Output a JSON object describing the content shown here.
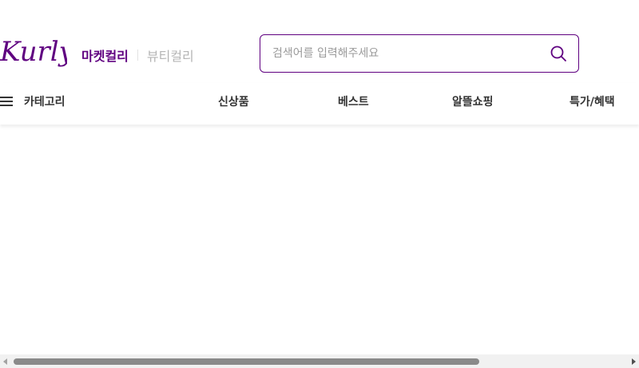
{
  "header": {
    "logo_text": "Kurly",
    "tabs": {
      "market": "마켓컬리",
      "beauty": "뷰티컬리"
    },
    "search": {
      "placeholder": "검색어를 입력해주세요",
      "value": ""
    }
  },
  "nav": {
    "category_label": "카테고리",
    "items": [
      "신상품",
      "베스트",
      "알뜰쇼핑",
      "특가/혜택"
    ]
  },
  "colors": {
    "brand": "#5f0080",
    "inactive_tab": "#b5b5b5",
    "text": "#333333"
  }
}
